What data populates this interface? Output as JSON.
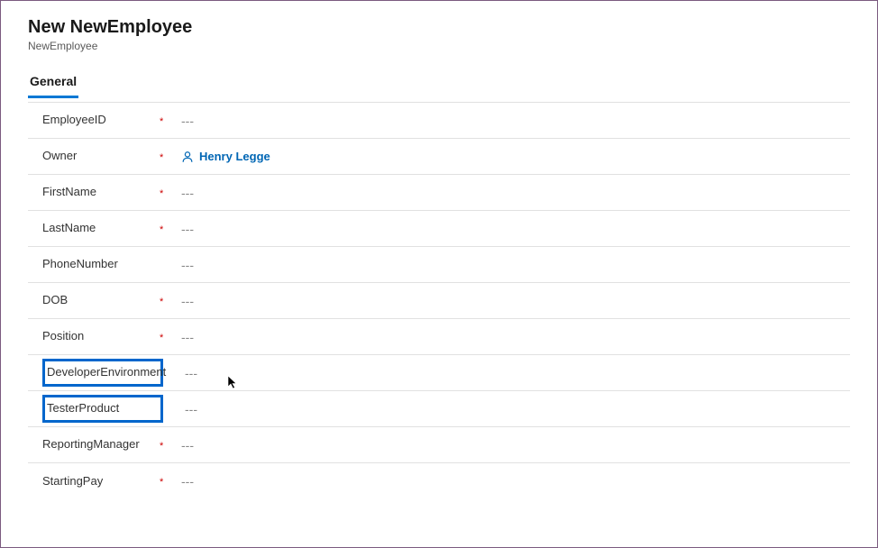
{
  "header": {
    "title": "New NewEmployee",
    "subtitle": "NewEmployee"
  },
  "tabs": {
    "general": "General"
  },
  "fields": {
    "employeeId": {
      "label": "EmployeeID",
      "required": true,
      "value": "---"
    },
    "owner": {
      "label": "Owner",
      "required": true,
      "lookup_value": "Henry Legge"
    },
    "firstName": {
      "label": "FirstName",
      "required": true,
      "value": "---"
    },
    "lastName": {
      "label": "LastName",
      "required": true,
      "value": "---"
    },
    "phoneNumber": {
      "label": "PhoneNumber",
      "required": false,
      "value": "---"
    },
    "dob": {
      "label": "DOB",
      "required": true,
      "value": "---"
    },
    "position": {
      "label": "Position",
      "required": true,
      "value": "---"
    },
    "devEnv": {
      "label": "DeveloperEnvironment",
      "required": false,
      "value": "---"
    },
    "testerProduct": {
      "label": "TesterProduct",
      "required": false,
      "value": "---"
    },
    "reportingManager": {
      "label": "ReportingManager",
      "required": true,
      "value": "---"
    },
    "startingPay": {
      "label": "StartingPay",
      "required": true,
      "value": "---"
    }
  },
  "marks": {
    "required": "*"
  }
}
